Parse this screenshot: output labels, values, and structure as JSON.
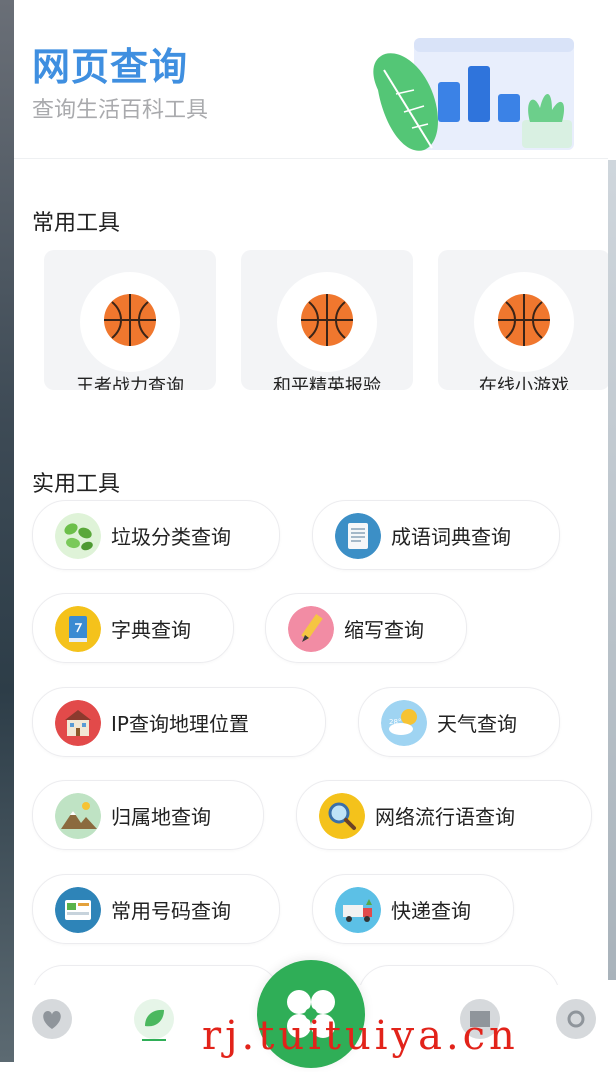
{
  "header": {
    "title": "网页查询",
    "subtitle": "查询生活百科工具"
  },
  "common_tools": {
    "title": "常用工具",
    "items": [
      {
        "label": "王者战力查询",
        "icon": "basketball-icon"
      },
      {
        "label": "和平精英报验",
        "icon": "basketball-icon"
      },
      {
        "label": "在线小游戏",
        "icon": "basketball-icon"
      }
    ]
  },
  "practical_tools": {
    "title": "实用工具",
    "items": [
      {
        "label": "垃圾分类查询",
        "icon": "leaves-icon"
      },
      {
        "label": "成语词典查询",
        "icon": "document-icon"
      },
      {
        "label": "字典查询",
        "icon": "book-icon"
      },
      {
        "label": "缩写查询",
        "icon": "pencil-icon"
      },
      {
        "label": "IP查询地理位置",
        "icon": "building-icon"
      },
      {
        "label": "天气查询",
        "icon": "weather-icon"
      },
      {
        "label": "归属地查询",
        "icon": "mountain-icon"
      },
      {
        "label": "网络流行语查询",
        "icon": "magnifier-icon"
      },
      {
        "label": "常用号码查询",
        "icon": "phonebook-icon"
      },
      {
        "label": "快递查询",
        "icon": "truck-icon"
      }
    ]
  },
  "bottom_nav": {
    "items": [
      "heart-icon",
      "leaf-icon",
      "clover-icon",
      "box-icon",
      "gear-icon"
    ]
  },
  "watermark": "rj.tuituiya.cn"
}
